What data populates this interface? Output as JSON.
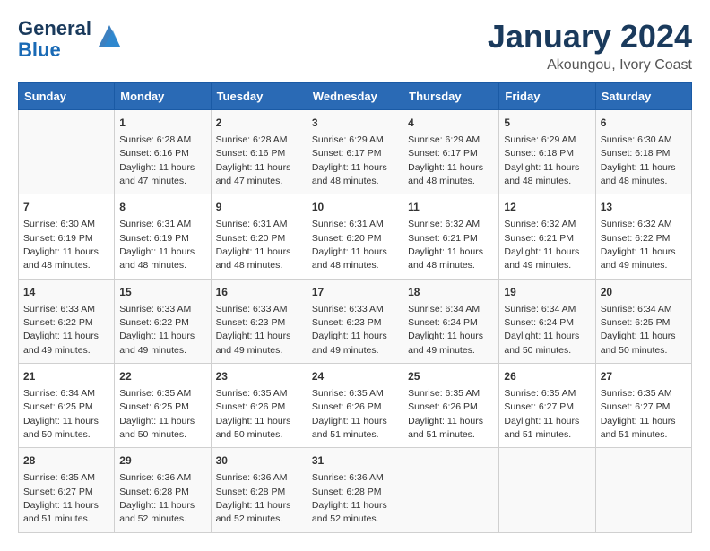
{
  "header": {
    "logo_line1": "General",
    "logo_line2": "Blue",
    "title": "January 2024",
    "subtitle": "Akoungou, Ivory Coast"
  },
  "days_of_week": [
    "Sunday",
    "Monday",
    "Tuesday",
    "Wednesday",
    "Thursday",
    "Friday",
    "Saturday"
  ],
  "weeks": [
    [
      {
        "day": "",
        "text": ""
      },
      {
        "day": "1",
        "text": "Sunrise: 6:28 AM\nSunset: 6:16 PM\nDaylight: 11 hours and 47 minutes."
      },
      {
        "day": "2",
        "text": "Sunrise: 6:28 AM\nSunset: 6:16 PM\nDaylight: 11 hours and 47 minutes."
      },
      {
        "day": "3",
        "text": "Sunrise: 6:29 AM\nSunset: 6:17 PM\nDaylight: 11 hours and 48 minutes."
      },
      {
        "day": "4",
        "text": "Sunrise: 6:29 AM\nSunset: 6:17 PM\nDaylight: 11 hours and 48 minutes."
      },
      {
        "day": "5",
        "text": "Sunrise: 6:29 AM\nSunset: 6:18 PM\nDaylight: 11 hours and 48 minutes."
      },
      {
        "day": "6",
        "text": "Sunrise: 6:30 AM\nSunset: 6:18 PM\nDaylight: 11 hours and 48 minutes."
      }
    ],
    [
      {
        "day": "7",
        "text": "Sunrise: 6:30 AM\nSunset: 6:19 PM\nDaylight: 11 hours and 48 minutes."
      },
      {
        "day": "8",
        "text": "Sunrise: 6:31 AM\nSunset: 6:19 PM\nDaylight: 11 hours and 48 minutes."
      },
      {
        "day": "9",
        "text": "Sunrise: 6:31 AM\nSunset: 6:20 PM\nDaylight: 11 hours and 48 minutes."
      },
      {
        "day": "10",
        "text": "Sunrise: 6:31 AM\nSunset: 6:20 PM\nDaylight: 11 hours and 48 minutes."
      },
      {
        "day": "11",
        "text": "Sunrise: 6:32 AM\nSunset: 6:21 PM\nDaylight: 11 hours and 48 minutes."
      },
      {
        "day": "12",
        "text": "Sunrise: 6:32 AM\nSunset: 6:21 PM\nDaylight: 11 hours and 49 minutes."
      },
      {
        "day": "13",
        "text": "Sunrise: 6:32 AM\nSunset: 6:22 PM\nDaylight: 11 hours and 49 minutes."
      }
    ],
    [
      {
        "day": "14",
        "text": "Sunrise: 6:33 AM\nSunset: 6:22 PM\nDaylight: 11 hours and 49 minutes."
      },
      {
        "day": "15",
        "text": "Sunrise: 6:33 AM\nSunset: 6:22 PM\nDaylight: 11 hours and 49 minutes."
      },
      {
        "day": "16",
        "text": "Sunrise: 6:33 AM\nSunset: 6:23 PM\nDaylight: 11 hours and 49 minutes."
      },
      {
        "day": "17",
        "text": "Sunrise: 6:33 AM\nSunset: 6:23 PM\nDaylight: 11 hours and 49 minutes."
      },
      {
        "day": "18",
        "text": "Sunrise: 6:34 AM\nSunset: 6:24 PM\nDaylight: 11 hours and 49 minutes."
      },
      {
        "day": "19",
        "text": "Sunrise: 6:34 AM\nSunset: 6:24 PM\nDaylight: 11 hours and 50 minutes."
      },
      {
        "day": "20",
        "text": "Sunrise: 6:34 AM\nSunset: 6:25 PM\nDaylight: 11 hours and 50 minutes."
      }
    ],
    [
      {
        "day": "21",
        "text": "Sunrise: 6:34 AM\nSunset: 6:25 PM\nDaylight: 11 hours and 50 minutes."
      },
      {
        "day": "22",
        "text": "Sunrise: 6:35 AM\nSunset: 6:25 PM\nDaylight: 11 hours and 50 minutes."
      },
      {
        "day": "23",
        "text": "Sunrise: 6:35 AM\nSunset: 6:26 PM\nDaylight: 11 hours and 50 minutes."
      },
      {
        "day": "24",
        "text": "Sunrise: 6:35 AM\nSunset: 6:26 PM\nDaylight: 11 hours and 51 minutes."
      },
      {
        "day": "25",
        "text": "Sunrise: 6:35 AM\nSunset: 6:26 PM\nDaylight: 11 hours and 51 minutes."
      },
      {
        "day": "26",
        "text": "Sunrise: 6:35 AM\nSunset: 6:27 PM\nDaylight: 11 hours and 51 minutes."
      },
      {
        "day": "27",
        "text": "Sunrise: 6:35 AM\nSunset: 6:27 PM\nDaylight: 11 hours and 51 minutes."
      }
    ],
    [
      {
        "day": "28",
        "text": "Sunrise: 6:35 AM\nSunset: 6:27 PM\nDaylight: 11 hours and 51 minutes."
      },
      {
        "day": "29",
        "text": "Sunrise: 6:36 AM\nSunset: 6:28 PM\nDaylight: 11 hours and 52 minutes."
      },
      {
        "day": "30",
        "text": "Sunrise: 6:36 AM\nSunset: 6:28 PM\nDaylight: 11 hours and 52 minutes."
      },
      {
        "day": "31",
        "text": "Sunrise: 6:36 AM\nSunset: 6:28 PM\nDaylight: 11 hours and 52 minutes."
      },
      {
        "day": "",
        "text": ""
      },
      {
        "day": "",
        "text": ""
      },
      {
        "day": "",
        "text": ""
      }
    ]
  ]
}
